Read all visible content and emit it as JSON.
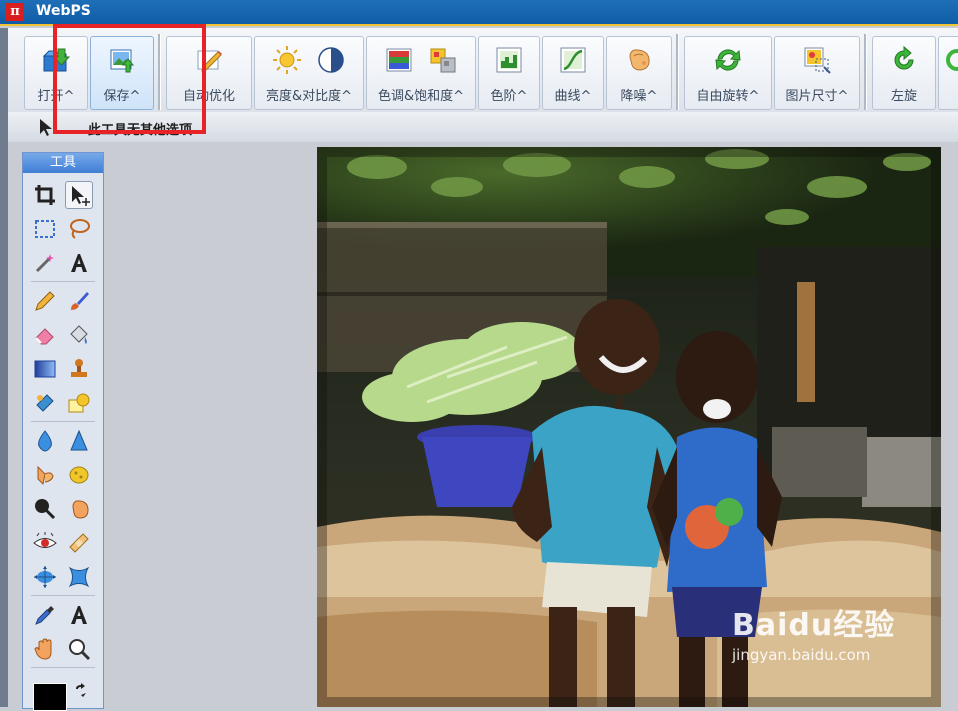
{
  "window": {
    "title": "WebPS"
  },
  "toolbar": {
    "buttons": [
      {
        "id": "open",
        "label": "打开^",
        "icon": "folder-open-icon"
      },
      {
        "id": "save",
        "label": "保存^",
        "icon": "save-image-icon"
      },
      {
        "id": "auto",
        "label": "自动优化",
        "icon": "auto-enhance-icon"
      },
      {
        "id": "brightness",
        "label": "亮度&对比度^",
        "icon": "sun-contrast-icon"
      },
      {
        "id": "hue",
        "label": "色调&饱和度^",
        "icon": "hue-saturation-icon"
      },
      {
        "id": "levels",
        "label": "色阶^",
        "icon": "levels-icon"
      },
      {
        "id": "curves",
        "label": "曲线^",
        "icon": "curves-icon"
      },
      {
        "id": "denoise",
        "label": "降噪^",
        "icon": "denoise-icon"
      },
      {
        "id": "rotate",
        "label": "自由旋转^",
        "icon": "free-rotate-icon"
      },
      {
        "id": "size",
        "label": "图片尺寸^",
        "icon": "image-size-icon"
      },
      {
        "id": "rotate-left",
        "label": "左旋",
        "icon": "rotate-left-icon"
      }
    ]
  },
  "options": {
    "text": "此工具无其他选项"
  },
  "toolbox": {
    "title": "工具",
    "tools": [
      "crop-icon",
      "move-select-icon",
      "rect-select-icon",
      "lasso-icon",
      "magic-wand-icon",
      "text-icon",
      "pencil-icon",
      "brush-icon",
      "eraser-icon",
      "paint-bucket-icon",
      "gradient-icon",
      "stamp-icon",
      "patch-icon",
      "shape-icon",
      "blur-drop-icon",
      "sharpen-icon",
      "smudge-icon",
      "sponge-icon",
      "dodge-icon",
      "burn-icon",
      "red-eye-icon",
      "bandage-icon",
      "transform-icon",
      "warp-icon",
      "eyedropper-icon",
      "text-type-icon",
      "hand-icon",
      "zoom-icon"
    ]
  },
  "watermark": {
    "logo": "Baidu经验",
    "url": "jingyan.baidu.com"
  },
  "colors": {
    "highlight": "#e82327",
    "title_bar": "#1466b1",
    "accent_strip": "#f3c431"
  }
}
